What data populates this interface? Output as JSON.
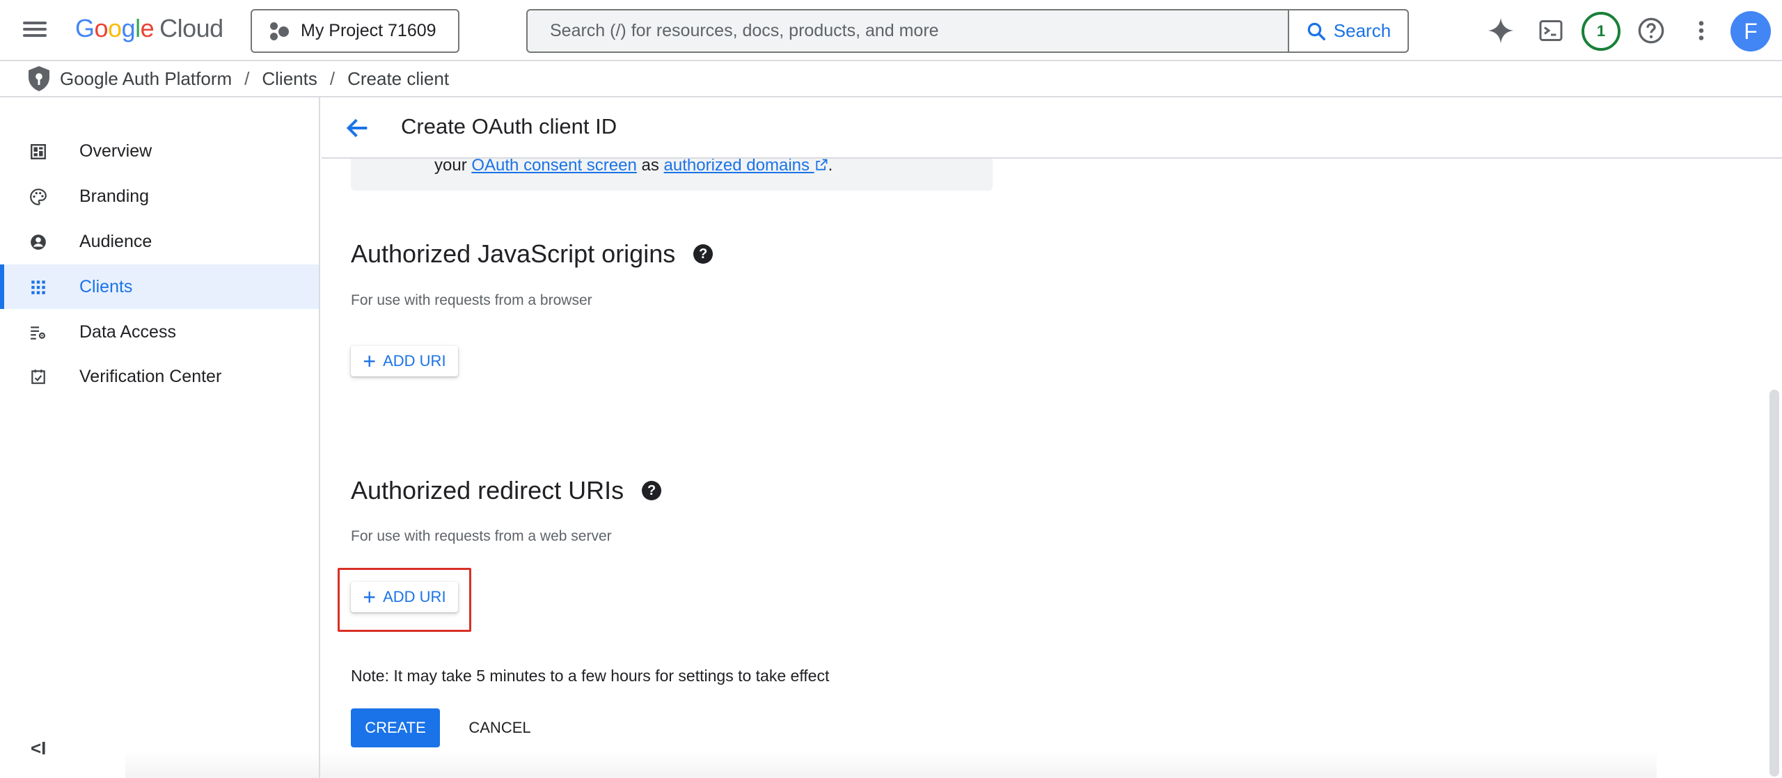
{
  "topbar": {
    "logo_google": "Google",
    "logo_cloud": "Cloud",
    "project_label": "My Project 71609",
    "search_placeholder": "Search (/) for resources, docs, products, and more",
    "search_button": "Search",
    "notification_count": "1",
    "avatar_letter": "F"
  },
  "breadcrumb": {
    "items": [
      "Google Auth Platform",
      "Clients",
      "Create client"
    ],
    "separator": "/"
  },
  "sidebar": {
    "items": [
      {
        "label": "Overview",
        "icon": "dashboard-icon"
      },
      {
        "label": "Branding",
        "icon": "palette-icon"
      },
      {
        "label": "Audience",
        "icon": "account-circle-icon"
      },
      {
        "label": "Clients",
        "icon": "apps-grid-icon",
        "active": true
      },
      {
        "label": "Data Access",
        "icon": "manage-search-icon"
      },
      {
        "label": "Verification Center",
        "icon": "checkbox-icon"
      }
    ],
    "collapse_label": "<I"
  },
  "header": {
    "title": "Create OAuth client ID"
  },
  "info": {
    "prefix": "your",
    "link1": "OAuth consent screen",
    "middle": "as",
    "link2": "authorized domains",
    "suffix": "."
  },
  "js_origins": {
    "title": "Authorized JavaScript origins",
    "description": "For use with requests from a browser",
    "add_button": "ADD URI"
  },
  "redirect_uris": {
    "title": "Authorized redirect URIs",
    "description": "For use with requests from a web server",
    "add_button": "ADD URI"
  },
  "footer": {
    "note": "Note: It may take 5 minutes to a few hours for settings to take effect",
    "create": "CREATE",
    "cancel": "CANCEL"
  },
  "colors": {
    "accent": "#1a73e8",
    "highlight": "#d93025",
    "active_bg": "#e8f0fe"
  }
}
